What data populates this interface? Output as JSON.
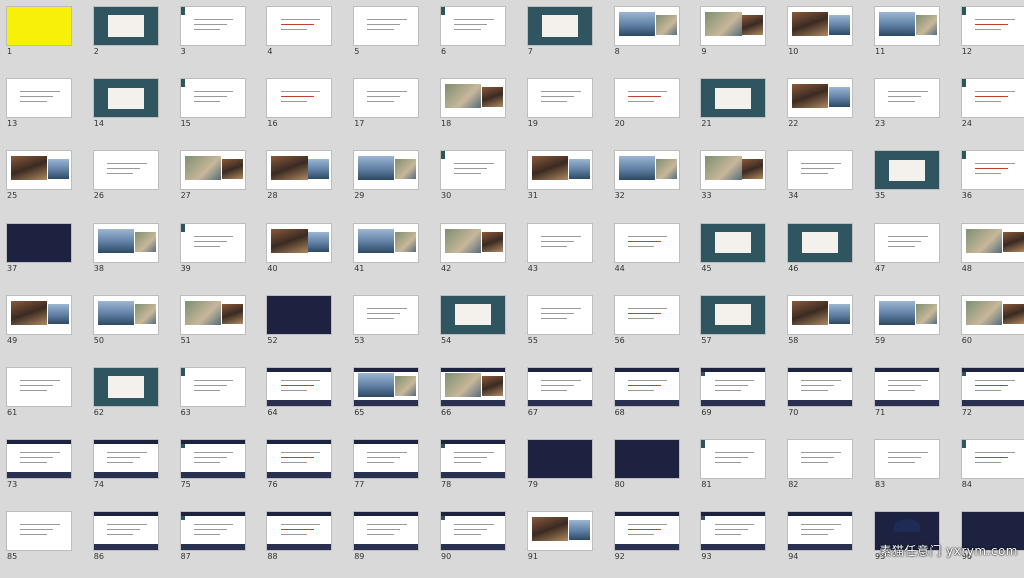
{
  "slides": [
    {
      "n": "1"
    },
    {
      "n": "2"
    },
    {
      "n": "3"
    },
    {
      "n": "4"
    },
    {
      "n": "5"
    },
    {
      "n": "6"
    },
    {
      "n": "7"
    },
    {
      "n": "8"
    },
    {
      "n": "9"
    },
    {
      "n": "10"
    },
    {
      "n": "11"
    },
    {
      "n": "12"
    },
    {
      "n": "13"
    },
    {
      "n": "14"
    },
    {
      "n": "15"
    },
    {
      "n": "16"
    },
    {
      "n": "17"
    },
    {
      "n": "18"
    },
    {
      "n": "19"
    },
    {
      "n": "20"
    },
    {
      "n": "21"
    },
    {
      "n": "22"
    },
    {
      "n": "23"
    },
    {
      "n": "24"
    },
    {
      "n": "25"
    },
    {
      "n": "26"
    },
    {
      "n": "27"
    },
    {
      "n": "28"
    },
    {
      "n": "29"
    },
    {
      "n": "30"
    },
    {
      "n": "31"
    },
    {
      "n": "32"
    },
    {
      "n": "33"
    },
    {
      "n": "34"
    },
    {
      "n": "35"
    },
    {
      "n": "36"
    },
    {
      "n": "37"
    },
    {
      "n": "38"
    },
    {
      "n": "39"
    },
    {
      "n": "40"
    },
    {
      "n": "41"
    },
    {
      "n": "42"
    },
    {
      "n": "43"
    },
    {
      "n": "44"
    },
    {
      "n": "45"
    },
    {
      "n": "46"
    },
    {
      "n": "47"
    },
    {
      "n": "48"
    },
    {
      "n": "49"
    },
    {
      "n": "50"
    },
    {
      "n": "51"
    },
    {
      "n": "52"
    },
    {
      "n": "53"
    },
    {
      "n": "54"
    },
    {
      "n": "55"
    },
    {
      "n": "56"
    },
    {
      "n": "57"
    },
    {
      "n": "58"
    },
    {
      "n": "59"
    },
    {
      "n": "60"
    },
    {
      "n": "61"
    },
    {
      "n": "62"
    },
    {
      "n": "63"
    },
    {
      "n": "64"
    },
    {
      "n": "65"
    },
    {
      "n": "66"
    },
    {
      "n": "67"
    },
    {
      "n": "68"
    },
    {
      "n": "69"
    },
    {
      "n": "70"
    },
    {
      "n": "71"
    },
    {
      "n": "72"
    },
    {
      "n": "73"
    },
    {
      "n": "74"
    },
    {
      "n": "75"
    },
    {
      "n": "76"
    },
    {
      "n": "77"
    },
    {
      "n": "78"
    },
    {
      "n": "79"
    },
    {
      "n": "80"
    },
    {
      "n": "81"
    },
    {
      "n": "82"
    },
    {
      "n": "83"
    },
    {
      "n": "84"
    },
    {
      "n": "85"
    },
    {
      "n": "86"
    },
    {
      "n": "87"
    },
    {
      "n": "88"
    },
    {
      "n": "89"
    },
    {
      "n": "90"
    },
    {
      "n": "91"
    },
    {
      "n": "92"
    },
    {
      "n": "93"
    },
    {
      "n": "94"
    },
    {
      "n": "95"
    },
    {
      "n": "96"
    }
  ],
  "watermark": "素猫任意门 yxrym.com",
  "colors": {
    "background": "#d9d9d9",
    "teal_slide": "#2f5660",
    "navy_slide": "#1c2240",
    "yellow_slide": "#f7f009"
  }
}
